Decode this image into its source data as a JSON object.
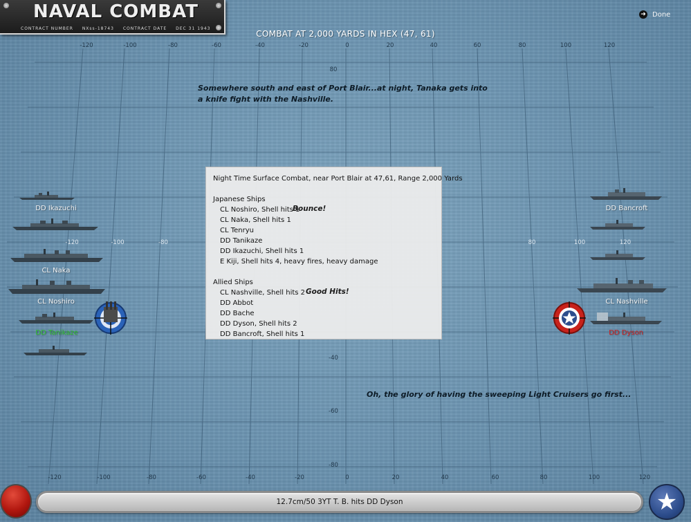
{
  "window": {
    "plate_title": "NAVAL COMBAT",
    "plate_sub": [
      "CONTRACT NUMBER",
      "NXss-18743",
      "CONTRACT DATE",
      "DEC 31 1943"
    ],
    "done_label": "Done",
    "header": "COMBAT AT 2,000 YARDS IN HEX (47, 61)"
  },
  "axis": {
    "top_ticks": [
      "-120",
      "-100",
      "-80",
      "-60",
      "-40",
      "-20",
      "0",
      "20",
      "40",
      "60",
      "80",
      "100",
      "120"
    ],
    "bottom_ticks": [
      "-120",
      "-100",
      "-80",
      "-60",
      "-40",
      "-20",
      "0",
      "20",
      "40",
      "60",
      "80",
      "100",
      "120"
    ],
    "mid_ticks_left": [
      "-120",
      "-100",
      "-80"
    ],
    "mid_ticks_right": [
      "80",
      "100",
      "120"
    ],
    "vertical_ticks": [
      "80",
      "-40",
      "-60",
      "-80"
    ]
  },
  "comments": {
    "top": "Somewhere south and east of Port Blair...at night, Tanaka gets into a knife fight with the Nashville.",
    "bottom": "Oh, the glory of having the sweeping Light Cruisers go first..."
  },
  "left_ship_labels": [
    "DD Ikazuchi",
    "CL Naka",
    "CL Noshiro",
    "DD Tanikaze"
  ],
  "right_ship_labels": [
    "DD Bancroft",
    "CL Nashville",
    "DD Dyson"
  ],
  "report": {
    "title": "Night Time Surface Combat, near Port Blair at 47,61, Range 2,000 Yards",
    "japanese_header": "Japanese Ships",
    "japanese": [
      "CL Noshiro, Shell hits 1",
      "CL Naka, Shell hits 1",
      "CL Tenryu",
      "DD Tanikaze",
      "DD Ikazuchi, Shell hits 1",
      "E Kiji, Shell hits 4,  heavy fires,  heavy damage"
    ],
    "allied_header": "Allied Ships",
    "allied": [
      "CL Nashville, Shell hits 2",
      "DD Abbot",
      "DD Bache",
      "DD Dyson, Shell hits 2",
      "DD Bancroft, Shell hits 1"
    ]
  },
  "callouts": {
    "bounce": "Bounce!",
    "good_hits": "Good Hits!"
  },
  "status_message": "12.7cm/50 3YT T. B. hits DD Dyson",
  "colors": {
    "japanese_target": "#2a62b8",
    "allied_target": "#c8221b",
    "active_green": "#31c431",
    "hit_red": "#d21e1e"
  },
  "icons": {
    "done": "arrow-right-circle-icon",
    "left_button": "red-ball-icon",
    "right_button": "white-star-icon"
  }
}
